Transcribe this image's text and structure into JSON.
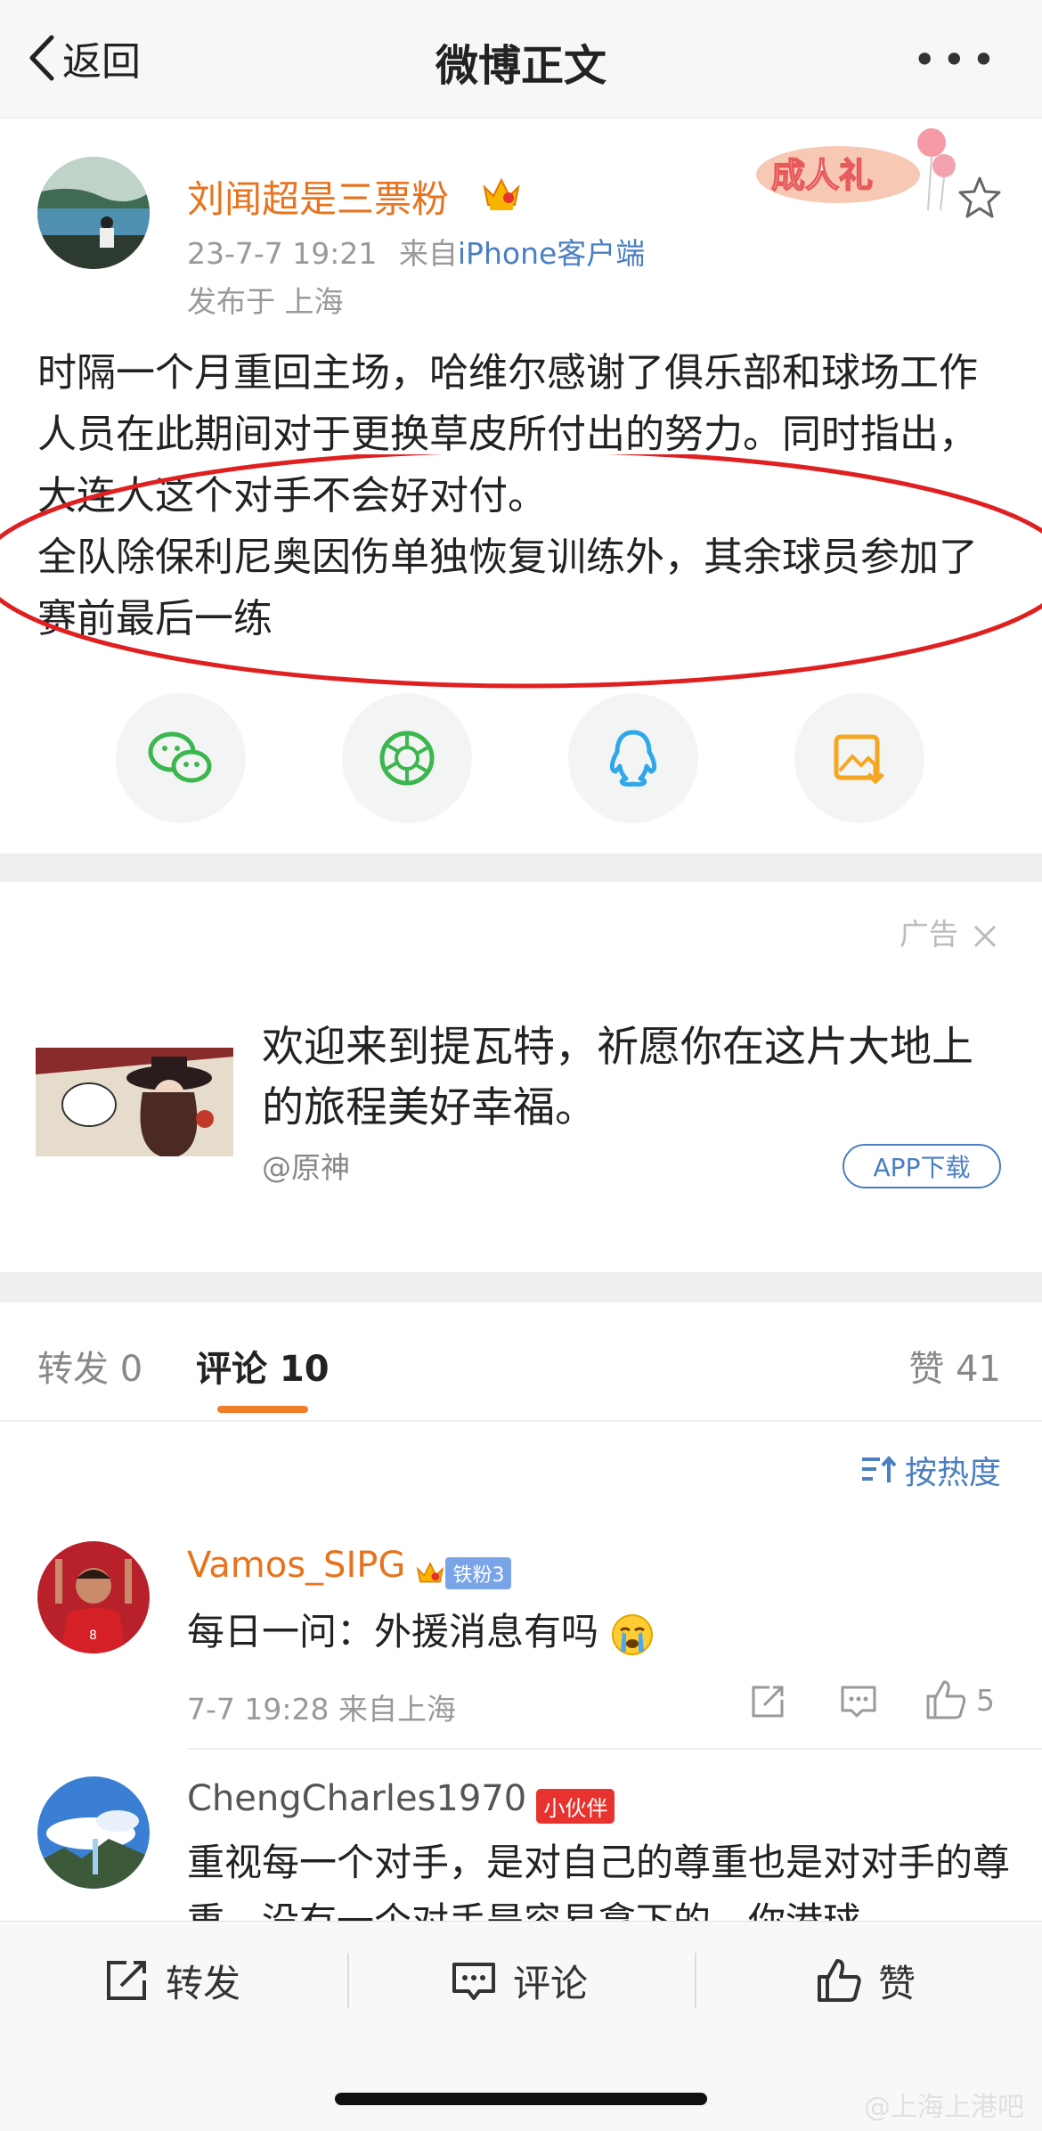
{
  "nav": {
    "back_label": "返回",
    "title": "微博正文",
    "more": "•••"
  },
  "post": {
    "username": "刘闻超是三票粉",
    "time": "23-7-7 19:21",
    "from_prefix": "来自",
    "source": "iPhone客户端",
    "location": "发布于 上海",
    "badge_text": "成人礼",
    "paragraphs": [
      "时隔一个月重回主场，哈维尔感谢了俱乐部和球场工作人员在此期间对于更换草皮所付出的努力。同时指出，大连人这个对手不会好对付。",
      "全队除保利尼奥因伤单独恢复训练外，其余球员参加了赛前最后一练"
    ],
    "share_icons": [
      "wechat-icon",
      "moments-icon",
      "qq-icon",
      "save-image-icon"
    ]
  },
  "ad": {
    "label": "广告",
    "text": "欢迎来到提瓦特，祈愿你在这片大地上的旅程美好幸福。",
    "by": "@原神",
    "button": "APP下载"
  },
  "tabs": {
    "repost": "转发 0",
    "comment": "评论 10",
    "like": "赞 41"
  },
  "sort_label": "按热度",
  "comments": [
    {
      "name": "Vamos_SIPG",
      "badge": "铁粉3",
      "text": "每日一问：外援消息有吗",
      "time_loc": "7-7 19:28  来自上海",
      "likes": "5"
    },
    {
      "name": "ChengCharles1970",
      "badge": "小伙伴",
      "text": "重视每一个对手，是对自己的尊重也是对对手的尊重，没有一个对手是容易拿下的，你港球"
    }
  ],
  "bottom_bar": {
    "repost": "转发",
    "comment": "评论",
    "like": "赞"
  },
  "watermark": "@上海上港吧",
  "colors": {
    "username": "#e8731d",
    "link": "#4a7fc1",
    "annotation": "#e02020",
    "tab_underline": "#f07d28"
  }
}
